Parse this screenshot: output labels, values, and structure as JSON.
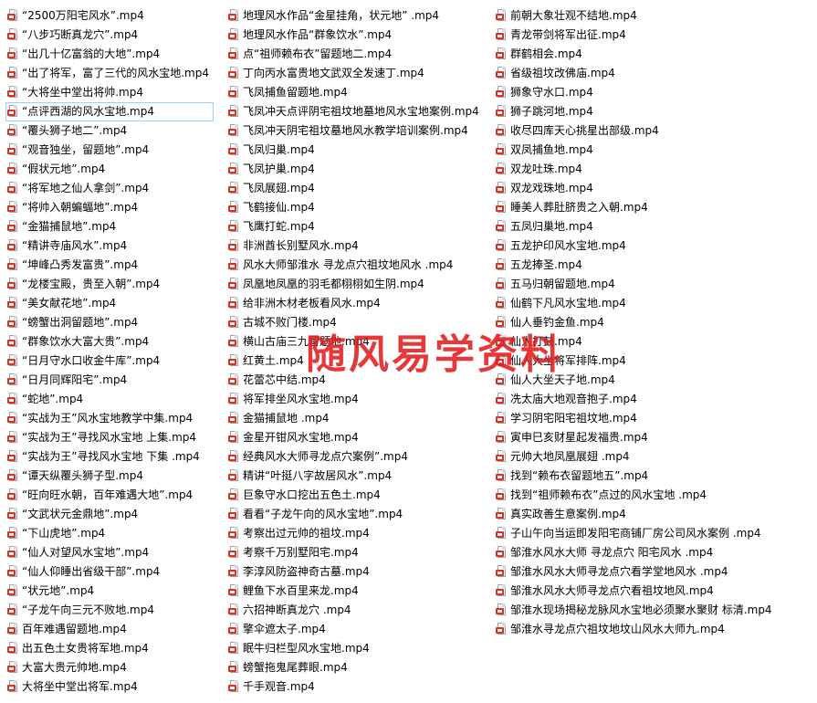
{
  "watermark": "随风易学资料",
  "selected_file": "“点评西湖的风水宝地.mp4",
  "icon": "video-file-icon",
  "columns": [
    [
      "“2500万阳宅风水”.mp4",
      "“八步巧断真龙穴”.mp4",
      "“出几十亿富翁的大地”.mp4",
      "“出了将军，富了三代的风水宝地.mp4",
      "“大将坐中堂出将帅.mp4",
      "“点评西湖的风水宝地.mp4",
      "“覆头狮子地二”.mp4",
      "“观音独坐，留题地”.mp4",
      "“假状元地”.mp4",
      "“将军地之仙人拿剑”.mp4",
      "“将帅入朝蝙蝠地”.mp4",
      "“金猫捕鼠地”.mp4",
      "“精讲寺庙风水”.mp4",
      "“坤峰凸秀发富贵”.mp4",
      "“龙楼宝殿，贵至入朝”.mp4",
      "“美女献花地”.mp4",
      "“螃蟹出洞留题地”.mp4",
      "“群象饮水大富大贵”.mp4",
      "“日月守水口收金牛库”.mp4",
      "“日月同辉阳宅”.mp4",
      "“蛇地”.mp4",
      "“实战为王”风水宝地教学中集.mp4",
      "“实战为王”寻找风水宝地 上集.mp4",
      "“实战为王”寻找风水宝地 下集 .mp4",
      "“谭天纵覆头狮子型.mp4",
      "“旺向旺水朝，百年难遇大地”.mp4",
      "“文武状元金鼎地”.mp4",
      "“下山虎地”.mp4",
      "“仙人对望风水宝地”.mp4",
      "“仙人仰睡出省级干部”.mp4",
      "“状元地”.mp4",
      "“子龙午向三元不败地.mp4",
      "百年难遇留题地.mp4",
      "出五色土女贵将军地.mp4",
      "大富大贵元帅地.mp4",
      "大将坐中堂出将军.mp4"
    ],
    [
      "地理风水作品“金星挂角，状元地” .mp4",
      "地理风水作品“群象饮水”.mp4",
      "点“祖师赖布衣”留题地二.mp4",
      "丁向丙水富贵地文武双全发速丁.mp4",
      "飞凤捕鱼留题地.mp4",
      "飞凤冲天点评阴宅祖坟地墓地风水宝地案例.mp4",
      "飞凤冲天阴宅祖坟墓地风水教学培训案例.mp4",
      "飞凤归巢.mp4",
      "飞凤护巢.mp4",
      "飞凤展翅.mp4",
      "飞鹤接仙.mp4",
      "飞鹰打蛇.mp4",
      "非洲酋长别墅风水.mp4",
      "风水大师邹淮水 寻龙点穴祖坟地风水 .mp4",
      "凤凰地凤凰的羽毛都栩栩如生阴.mp4",
      "给非洲木材老板看风水.mp4",
      "古城不败门楼.mp4",
      "横山古庙三九留题地.mp4",
      "红黄土.mp4",
      "花蕾芯中结.mp4",
      "将军排坐风水宝地.mp4",
      "金猫捕鼠地 .mp4",
      "金星开钳风水宝地.mp4",
      "经典风水大师寻龙点穴案例”.mp4",
      "精讲“叶挺八字故居风水”.mp4",
      "巨象守水口挖出五色土.mp4",
      "看看“子龙午向的风水宝地”.mp4",
      "考察出过元帅的祖坟.mp4",
      "考察千万别墅阳宅.mp4",
      "李淳风防盗神奇古墓.mp4",
      "鲤鱼下水百里来龙.mp4",
      "六招神断真龙穴 .mp4",
      "擎伞遮太子.mp4",
      "眠牛归栏型风水宝地.mp4",
      "螃蟹拖鬼尾葬眼.mp4",
      "千手观音.mp4"
    ],
    [
      "前朝大象壮观不结地.mp4",
      "青龙带剑将军出征.mp4",
      "群鹤相会.mp4",
      "省级祖坟改佛庙.mp4",
      "狮象守水口.mp4",
      "狮子跳河地.mp4",
      "收尽四库天心挑星出部级.mp4",
      "双凤捕鱼地.mp4",
      "双龙吐珠.mp4",
      "双龙戏珠地.mp4",
      "睡美人葬肚脐贵之入朝.mp4",
      "五凤归巢地.mp4",
      "五龙护印风水宝地.mp4",
      "五龙捧圣.mp4",
      "五马归朝留题地.mp4",
      "仙鹤下凡风水宝地.mp4",
      "仙人垂钓金鱼.mp4",
      "仙人打鼓.mp4",
      "仙人大坐将军排阵.mp4",
      "仙人大坐天子地.mp4",
      "冼太庙大地观音抱子.mp4",
      "学习阴宅阳宅祖坟地.mp4",
      "寅申巳亥财星起发福贵.mp4",
      "元帅大地凤凰展翅 .mp4",
      "找到“赖布衣留题地五”.mp4",
      "找到“祖师赖布衣”点过的风水宝地 .mp4",
      "真实政善生意案例.mp4",
      "子山午向当运即发阳宅商铺厂房公司风水案例 .mp4",
      "邹淮水风水大师 寻龙点穴 阳宅风水 .mp4",
      "邹淮水风水大师寻龙点穴看学堂地风水 .mp4",
      "邹淮水风水大师寻龙点穴看祖坟地风.mp4",
      "邹淮水现场揭秘龙脉风水宝地必须聚水聚财 标清.mp4",
      "邹淮水寻龙点穴祖坟地坟山风水大师九.mp4"
    ]
  ]
}
